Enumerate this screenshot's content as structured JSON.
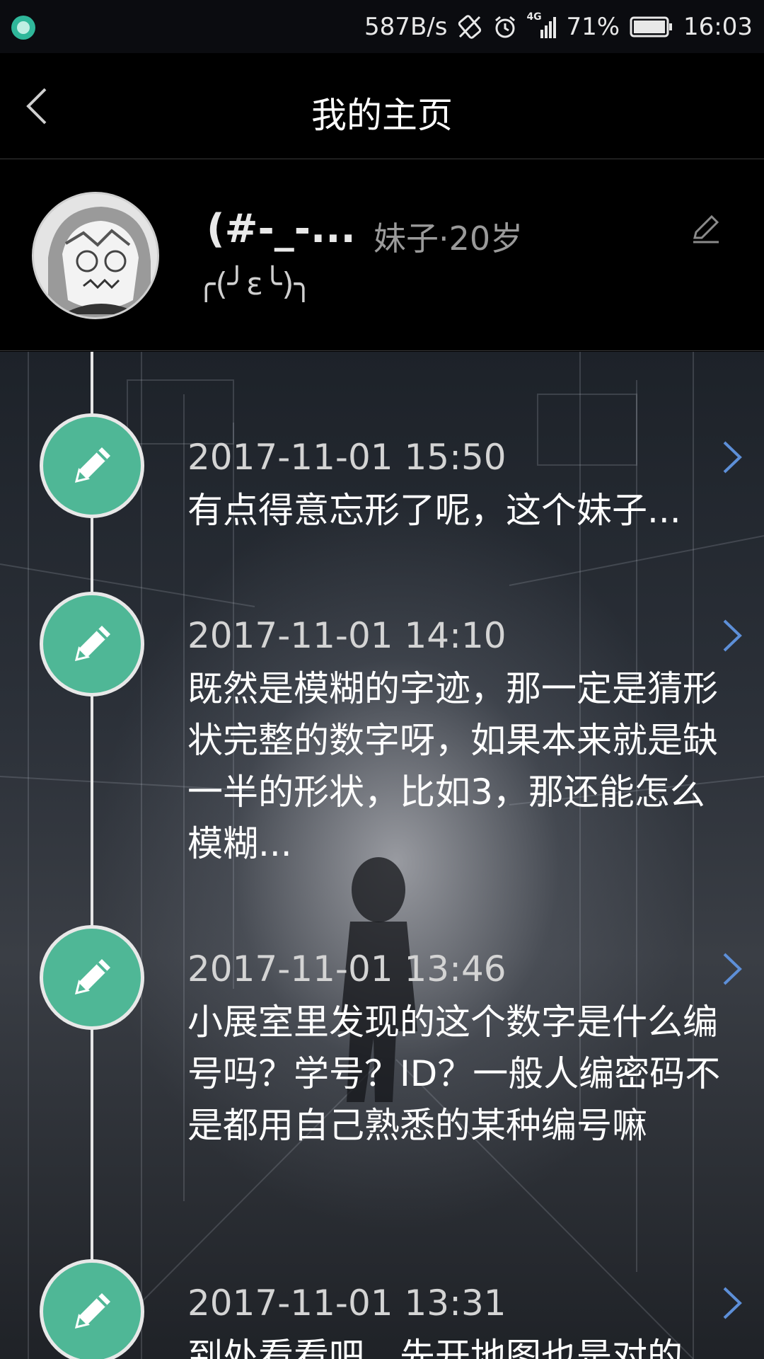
{
  "status_bar": {
    "net_speed": "587B/s",
    "signal_type": "4G",
    "battery_percent": "71%",
    "time": "16:03",
    "icons": [
      "app-notification-icon",
      "rotate-icon",
      "alarm-icon",
      "signal-icon",
      "battery-icon"
    ]
  },
  "header": {
    "title": "我的主页",
    "back_icon": "chevron-left-icon"
  },
  "profile": {
    "nickname": "(#-_-...",
    "gender_age": "妹子·20岁",
    "signature": "╭(╯ε╰)╮",
    "edit_icon": "pencil-icon"
  },
  "timeline": {
    "accent_color": "#4fb796",
    "entries": [
      {
        "time": "2017-11-01 15:50",
        "text": "有点得意忘形了呢，这个妹子..."
      },
      {
        "time": "2017-11-01 14:10",
        "text": "既然是模糊的字迹，那一定是猜形状完整的数字呀，如果本来就是缺一半的形状，比如3，那还能怎么模糊..."
      },
      {
        "time": "2017-11-01 13:46",
        "text": "小展室里发现的这个数字是什么编号吗？学号？ID？一般人编密码不是都用自己熟悉的某种编号嘛"
      },
      {
        "time": "2017-11-01 13:31",
        "text": "到处看看吧，先开地图也是对的"
      }
    ]
  }
}
